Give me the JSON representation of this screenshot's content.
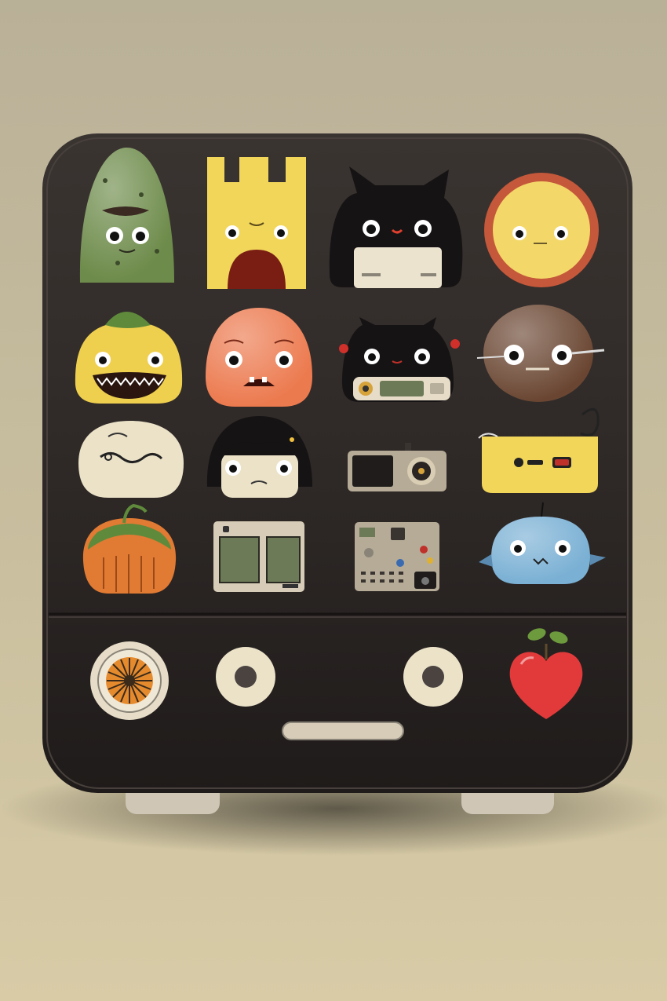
{
  "scene": {
    "subject": "toy-cabinet",
    "colors": {
      "background": "#c4ba9c",
      "cabinet": "#2b2624",
      "cabinet_edge": "#3a3330",
      "foot": "#cfc6b6",
      "cream": "#ebe2c8",
      "green": "#6d8b4a",
      "yellow": "#f2d65a",
      "black": "#151314",
      "sun": "#f3d869",
      "sun_rim": "#c5583a",
      "orange": "#ec7a4f",
      "brown": "#6a4632",
      "pumpkin": "#e17a33",
      "blue": "#7ab0d4",
      "red": "#e23a3a",
      "leaf": "#6d9a3d"
    },
    "magnets": [
      "green-cactus-monster",
      "yellow-castle-monster",
      "black-cat-cassette",
      "sun-face",
      "eggplant-monster",
      "orange-blob-monster",
      "black-cat-radio",
      "brown-cookie-monster",
      "cream-mochi",
      "black-haired-blob",
      "cassette-player",
      "yellow-tape-recorder",
      "pumpkin",
      "green-screen-panel",
      "control-panel",
      "blue-fish-monster"
    ],
    "drawer_items": [
      "orange-dial",
      "left-knob",
      "drawer-handle",
      "right-knob",
      "red-heart-apple"
    ]
  }
}
